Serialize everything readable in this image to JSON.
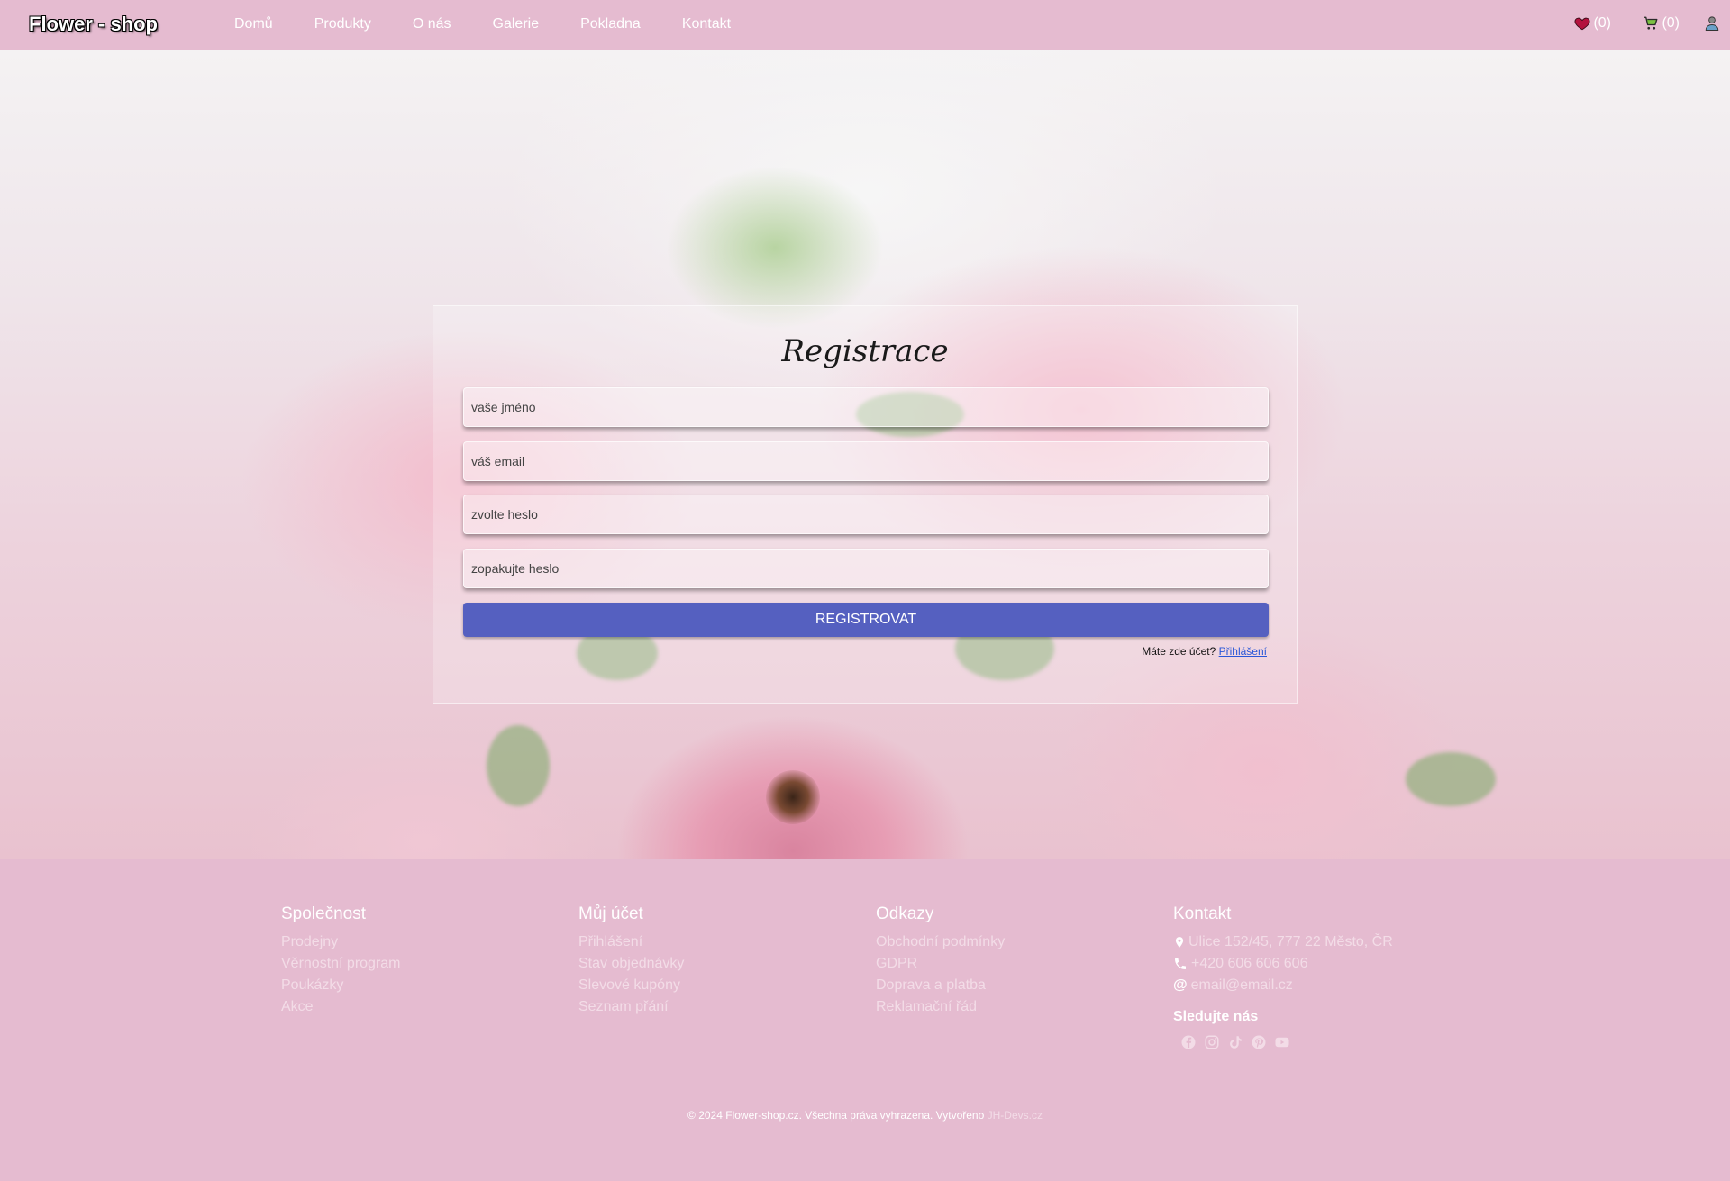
{
  "navbar": {
    "brand": "Flower - shop",
    "links": [
      "Domů",
      "Produkty",
      "O nás",
      "Galerie",
      "Pokladna",
      "Kontakt"
    ],
    "wishlist_count": "(0)",
    "cart_count": "(0)",
    "icons": [
      "heart-icon",
      "cart-icon",
      "user-icon"
    ]
  },
  "form": {
    "title": "Registrace",
    "name_placeholder": "vaše jméno",
    "email_placeholder": "váš email",
    "password_placeholder": "zvolte heslo",
    "password_repeat_placeholder": "zopakujte heslo",
    "submit_label": "REGISTROVAT",
    "has_account_text": "Máte zde účet?",
    "login_link": "Přihlášení",
    "button_color": "#5560c0"
  },
  "footer": {
    "company": {
      "title": "Společnost",
      "links": [
        "Prodejny",
        "Věrnostní program",
        "Poukázky",
        "Akce"
      ]
    },
    "account": {
      "title": "Můj účet",
      "links": [
        "Přihlášení",
        "Stav objednávky",
        "Slevové kupóny",
        "Seznam přání"
      ]
    },
    "links": {
      "title": "Odkazy",
      "links": [
        "Obchodní podmínky",
        "GDPR",
        "Doprava a platba",
        "Reklamační řád"
      ]
    },
    "contact": {
      "title": "Kontakt",
      "address": "Ulice 152/45, 777 22 Město, ČR",
      "phone": "+420 606 606 606",
      "email": "email@email.cz",
      "follow_title": "Sledujte nás",
      "socials": [
        "facebook-icon",
        "instagram-icon",
        "tiktok-icon",
        "pinterest-icon",
        "youtube-icon"
      ]
    },
    "copyright": "© 2024 Flower-shop.cz. Všechna práva vyhrazena. Vytvořeno",
    "developer": "JH-Devs.cz"
  },
  "colors": {
    "background": "#e5bbd0",
    "accent": "#5560c0"
  }
}
